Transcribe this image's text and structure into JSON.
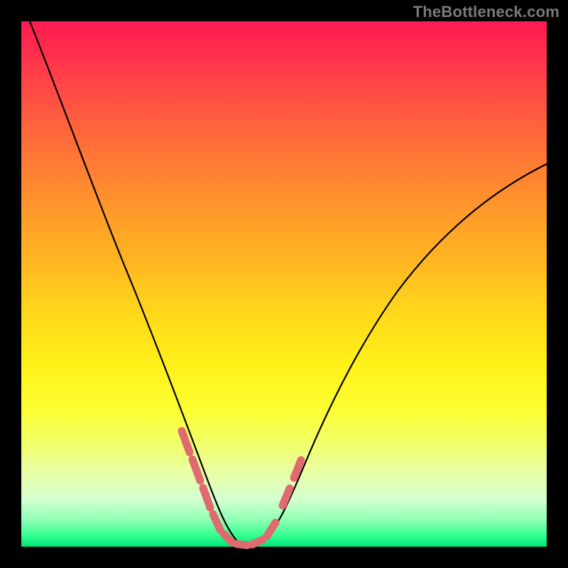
{
  "watermark": "TheBottleneck.com",
  "colors": {
    "background": "#000000",
    "curve": "#000000",
    "highlight": "#e06a6f",
    "gradient_top": "#ff1a53",
    "gradient_bottom": "#00e27a"
  },
  "chart_data": {
    "type": "line",
    "title": "",
    "xlabel": "",
    "ylabel": "",
    "xlim": [
      0,
      100
    ],
    "ylim": [
      0,
      100
    ],
    "grid": false,
    "legend": false,
    "series": [
      {
        "name": "bottleneck-curve",
        "x": [
          0,
          4,
          8,
          12,
          16,
          20,
          24,
          28,
          30,
          32,
          34,
          36,
          38,
          40,
          42,
          44,
          46,
          50,
          54,
          58,
          62,
          66,
          70,
          74,
          78,
          82,
          86,
          90,
          94,
          98,
          100
        ],
        "y": [
          100,
          91,
          82,
          73,
          64,
          55,
          46,
          35,
          28,
          21,
          14,
          8,
          4,
          1,
          0,
          0,
          2,
          8,
          14,
          21,
          28,
          34,
          40,
          46,
          51,
          56,
          60,
          64,
          68,
          71,
          73
        ]
      }
    ],
    "highlight_segments": [
      {
        "x": [
          28,
          30
        ],
        "y": [
          35,
          28
        ]
      },
      {
        "x": [
          30,
          32.5
        ],
        "y": [
          24,
          15
        ]
      },
      {
        "x": [
          32.5,
          34
        ],
        "y": [
          15,
          9
        ]
      },
      {
        "x": [
          34,
          36
        ],
        "y": [
          8,
          4
        ]
      },
      {
        "x": [
          36,
          38
        ],
        "y": [
          4,
          1.5
        ]
      },
      {
        "x": [
          38,
          40
        ],
        "y": [
          1.5,
          0.5
        ]
      },
      {
        "x": [
          40,
          42
        ],
        "y": [
          0.5,
          0
        ]
      },
      {
        "x": [
          42,
          44
        ],
        "y": [
          0,
          0.5
        ]
      },
      {
        "x": [
          44,
          46
        ],
        "y": [
          0.5,
          2
        ]
      },
      {
        "x": [
          46,
          48
        ],
        "y": [
          3,
          6
        ]
      },
      {
        "x": [
          48,
          50
        ],
        "y": [
          7,
          10
        ]
      },
      {
        "x": [
          49,
          51
        ],
        "y": [
          15,
          20
        ]
      },
      {
        "x": [
          50,
          52
        ],
        "y": [
          22,
          27
        ]
      }
    ]
  }
}
